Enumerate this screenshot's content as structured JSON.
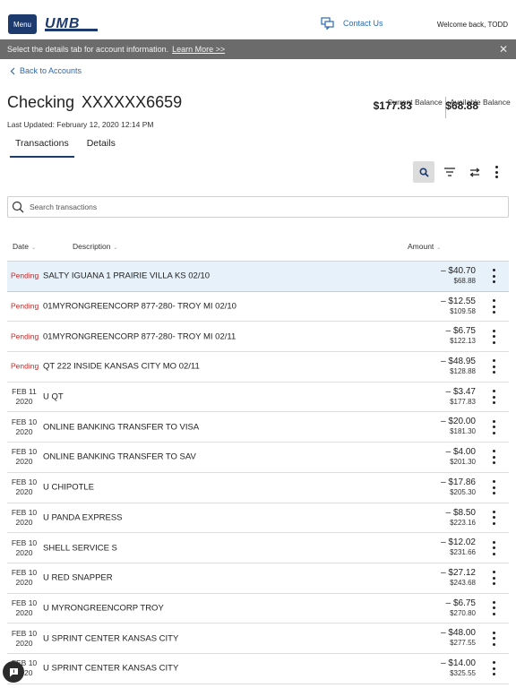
{
  "header": {
    "menu_label": "Menu",
    "logo_text": "UMB",
    "contact_label": "Contact Us",
    "welcome": "Welcome back, TODD"
  },
  "banner": {
    "text": "Select the details tab for account information.",
    "link": "Learn More >>"
  },
  "nav": {
    "back_label": "Back to Accounts"
  },
  "account": {
    "type": "Checking",
    "number": "XXXXXX6659",
    "last_updated": "Last Updated: February 12, 2020 12:14 PM",
    "current_balance": "$177.83",
    "current_balance_label": "Current Balance",
    "available_balance": "$68.88",
    "available_balance_label": "Available Balance"
  },
  "tabs": [
    {
      "label": "Transactions",
      "active": true
    },
    {
      "label": "Details",
      "active": false
    }
  ],
  "search": {
    "placeholder": "Search transactions"
  },
  "columns": {
    "date": "Date",
    "description": "Description",
    "amount": "Amount"
  },
  "transactions": [
    {
      "date": "Pending",
      "date2": "",
      "pending": true,
      "desc": "SALTY IGUANA 1 PRAIRIE VILLA KS 02/10",
      "amount": "– $40.70",
      "balance": "$68.88",
      "selected": true
    },
    {
      "date": "Pending",
      "date2": "",
      "pending": true,
      "desc": "01MYRONGREENCORP 877-280- TROY MI 02/10",
      "amount": "– $12.55",
      "balance": "$109.58"
    },
    {
      "date": "Pending",
      "date2": "",
      "pending": true,
      "desc": "01MYRONGREENCORP 877-280- TROY MI 02/11",
      "amount": "– $6.75",
      "balance": "$122.13"
    },
    {
      "date": "Pending",
      "date2": "",
      "pending": true,
      "desc": "QT 222 INSIDE KANSAS CITY MO 02/11",
      "amount": "– $48.95",
      "balance": "$128.88"
    },
    {
      "date": "FEB 11",
      "date2": "2020",
      "desc": "U QT",
      "amount": "– $3.47",
      "balance": "$177.83"
    },
    {
      "date": "FEB 10",
      "date2": "2020",
      "desc": "ONLINE BANKING TRANSFER TO VISA",
      "amount": "– $20.00",
      "balance": "$181.30"
    },
    {
      "date": "FEB 10",
      "date2": "2020",
      "desc": "ONLINE BANKING TRANSFER TO SAV",
      "amount": "– $4.00",
      "balance": "$201.30"
    },
    {
      "date": "FEB 10",
      "date2": "2020",
      "desc": "U CHIPOTLE",
      "amount": "– $17.86",
      "balance": "$205.30"
    },
    {
      "date": "FEB 10",
      "date2": "2020",
      "desc": "U PANDA EXPRESS",
      "amount": "– $8.50",
      "balance": "$223.16"
    },
    {
      "date": "FEB 10",
      "date2": "2020",
      "desc": "SHELL SERVICE S",
      "amount": "– $12.02",
      "balance": "$231.66"
    },
    {
      "date": "FEB 10",
      "date2": "2020",
      "desc": "U RED SNAPPER",
      "amount": "– $27.12",
      "balance": "$243.68"
    },
    {
      "date": "FEB 10",
      "date2": "2020",
      "desc": "U MYRONGREENCORP TROY",
      "amount": "– $6.75",
      "balance": "$270.80"
    },
    {
      "date": "FEB 10",
      "date2": "2020",
      "desc": "U SPRINT CENTER KANSAS CITY",
      "amount": "– $48.00",
      "balance": "$277.55"
    },
    {
      "date": "FEB 10",
      "date2": "2020",
      "desc": "U SPRINT CENTER KANSAS CITY",
      "amount": "– $14.00",
      "balance": "$325.55"
    }
  ],
  "icons": {
    "chat": "chat-bubble-icon",
    "search": "search-icon",
    "filter": "filter-icon",
    "transfer": "transfer-icon",
    "more": "more-vertical-icon"
  },
  "colors": {
    "brand_navy": "#1d3a6e",
    "link_blue": "#2a6ab4",
    "pending_red": "#c62828",
    "banner_gray": "#6b6b6b",
    "selected_row": "#e6f1fa"
  }
}
